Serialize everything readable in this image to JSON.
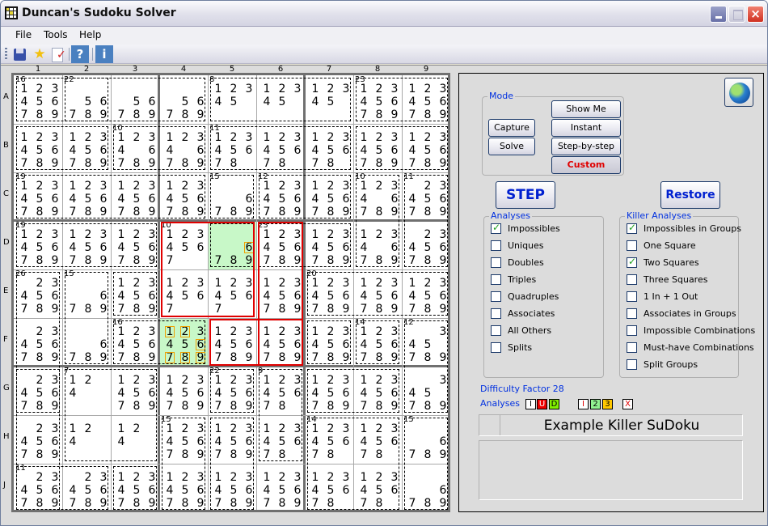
{
  "window": {
    "title": "Duncan's Sudoku Solver"
  },
  "menu": [
    {
      "label": "File",
      "mnemonic": "F"
    },
    {
      "label": "Tools",
      "mnemonic": "T"
    },
    {
      "label": "Help",
      "mnemonic": "H"
    }
  ],
  "toolbar": [
    {
      "icon": "save-icon"
    },
    {
      "icon": "favorite-star-icon"
    },
    {
      "icon": "check-document-icon"
    },
    {
      "icon": "help-icon",
      "label": "?"
    },
    {
      "icon": "info-icon",
      "label": "i"
    }
  ],
  "board": {
    "columns": [
      "1",
      "2",
      "3",
      "4",
      "5",
      "6",
      "7",
      "8",
      "9"
    ],
    "rows": [
      "A",
      "B",
      "C",
      "D",
      "E",
      "F",
      "G",
      "H",
      "J"
    ],
    "cells": [
      [
        "123456789",
        "56789",
        "56789",
        "56789",
        "12345",
        "12345",
        "12345",
        "123456789",
        "123456789"
      ],
      [
        "123456789",
        "123456789",
        "12346789",
        "12346789",
        "12345678",
        "12345678",
        "12345678",
        "123456789",
        "123456789"
      ],
      [
        "123456789",
        "123456789",
        "123456789",
        "123456789",
        "6789",
        "123456789",
        "123456789",
        "12346789",
        "23456789"
      ],
      [
        "123456789",
        "123456789",
        "123456789",
        "1234567",
        "6789",
        "123456789",
        "123456789",
        "12346789",
        "23456789"
      ],
      [
        "23456789",
        "6789",
        "123456789",
        "1234567",
        "1234567",
        "123456789",
        "123456789",
        "123456789",
        "123456789"
      ],
      [
        "23456789",
        "6789",
        "123456789",
        "123456789",
        "123456789",
        "123456789",
        "123456789",
        "123456789",
        "345789"
      ],
      [
        "23456789",
        "124",
        "123456789",
        "123456789",
        "123456789",
        "12345678",
        "123456789",
        "123456789",
        "345789"
      ],
      [
        "23456789",
        "124",
        "124",
        "123456789",
        "123456789",
        "12345678",
        "12345678",
        "12345678",
        "6789"
      ],
      [
        "23456789",
        "23456789",
        "123456789",
        "123456789",
        "123456789",
        "123456789",
        "12345678",
        "12345678",
        "6789"
      ]
    ],
    "cage_sums": [
      {
        "cell": "A1",
        "sum": "16"
      },
      {
        "cell": "A2",
        "sum": "22"
      },
      {
        "cell": "A5",
        "sum": "8"
      },
      {
        "cell": "A8",
        "sum": "23"
      },
      {
        "cell": "B3",
        "sum": "10"
      },
      {
        "cell": "B5",
        "sum": "11"
      },
      {
        "cell": "C1",
        "sum": "19"
      },
      {
        "cell": "C5",
        "sum": "15"
      },
      {
        "cell": "C6",
        "sum": "12"
      },
      {
        "cell": "C8",
        "sum": "10"
      },
      {
        "cell": "C9",
        "sum": "11"
      },
      {
        "cell": "D1",
        "sum": "19"
      },
      {
        "cell": "D4",
        "sum": "10"
      },
      {
        "cell": "D6",
        "sum": "23"
      },
      {
        "cell": "E1",
        "sum": "26"
      },
      {
        "cell": "E2",
        "sum": "15"
      },
      {
        "cell": "E7",
        "sum": "20"
      },
      {
        "cell": "F3",
        "sum": "16"
      },
      {
        "cell": "F8",
        "sum": "14"
      },
      {
        "cell": "F9",
        "sum": "12"
      },
      {
        "cell": "G2",
        "sum": "7"
      },
      {
        "cell": "G5",
        "sum": "22"
      },
      {
        "cell": "G6",
        "sum": "9"
      },
      {
        "cell": "H4",
        "sum": "15"
      },
      {
        "cell": "H7",
        "sum": "14"
      },
      {
        "cell": "H9",
        "sum": "15"
      },
      {
        "cell": "J1",
        "sum": "11"
      }
    ],
    "highlighted_cells": [
      "D5",
      "F4"
    ],
    "highlighted_candidates": [
      {
        "cell": "D5",
        "digits": "6"
      },
      {
        "cell": "F4",
        "digits": "126789"
      }
    ],
    "colors": {
      "highlight_cell": "#c8f8c8",
      "candidate_box": "#f0a000",
      "group_outline": "#e00000"
    }
  },
  "panel": {
    "mode": {
      "label": "Mode",
      "buttons": {
        "capture": "Capture",
        "solve": "Solve",
        "show_me": "Show Me",
        "instant": "Instant",
        "step_by_step": "Step-by-step",
        "custom": "Custom"
      },
      "selected": "Custom"
    },
    "step_label": "STEP",
    "restore_label": "Restore",
    "analyses": {
      "label": "Analyses",
      "items": [
        {
          "label": "Impossibles",
          "checked": true
        },
        {
          "label": "Uniques",
          "checked": false
        },
        {
          "label": "Doubles",
          "checked": false
        },
        {
          "label": "Triples",
          "checked": false
        },
        {
          "label": "Quadruples",
          "checked": false
        },
        {
          "label": "Associates",
          "checked": false
        },
        {
          "label": "All Others",
          "checked": false
        },
        {
          "label": "Splits",
          "checked": false
        }
      ]
    },
    "killer_analyses": {
      "label": "Killer Analyses",
      "items": [
        {
          "label": "Impossibles in Groups",
          "checked": true
        },
        {
          "label": "One Square",
          "checked": false
        },
        {
          "label": "Two Squares",
          "checked": true
        },
        {
          "label": "Three Squares",
          "checked": false
        },
        {
          "label": "1 In + 1 Out",
          "checked": false
        },
        {
          "label": "Associates in Groups",
          "checked": false
        },
        {
          "label": "Impossible Combinations",
          "checked": false
        },
        {
          "label": "Must-have Combinations",
          "checked": false
        },
        {
          "label": "Split Groups",
          "checked": false
        }
      ]
    },
    "difficulty": "Difficulty Factor 28",
    "analyses_indicator_label": "Analyses",
    "indicators": [
      {
        "text": "I",
        "bg": "#ffffff",
        "fg": "#000000"
      },
      {
        "text": "U",
        "bg": "#ee0000",
        "fg": "#ffffff"
      },
      {
        "text": "D",
        "bg": "#80f000",
        "fg": "#000000"
      },
      {
        "text": "I",
        "bg": "#ffffff",
        "fg": "#e00000"
      },
      {
        "text": "2",
        "bg": "#90f090",
        "fg": "#000000"
      },
      {
        "text": "3",
        "bg": "#ffc800",
        "fg": "#000000"
      },
      {
        "text": "X",
        "bg": "#ffffff",
        "fg": "#e00000"
      }
    ],
    "puzzle_name": "Example Killer SuDoku",
    "notes": ""
  }
}
